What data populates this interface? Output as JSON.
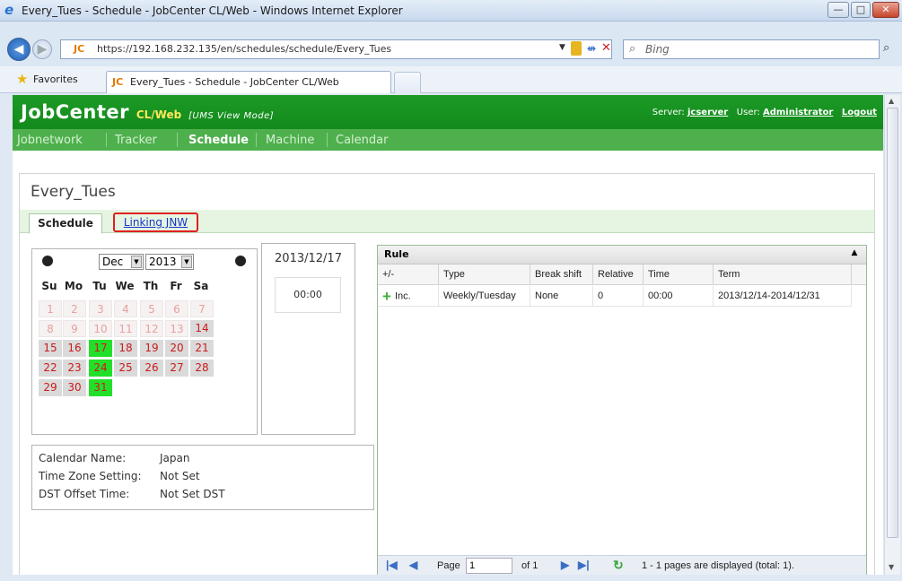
{
  "window": {
    "title": "Every_Tues - Schedule - JobCenter CL/Web - Windows Internet Explorer",
    "minimize": "—",
    "maximize": "□",
    "close": "✕"
  },
  "browser": {
    "back_glyph": "◀",
    "forward_glyph": "▶",
    "site_icon": "JC",
    "url": "https://192.168.232.135/en/schedules/schedule/Every_Tues",
    "search_placeholder": "Bing",
    "search_glyph": "⌕",
    "favorites": "Favorites",
    "tab_title": "Every_Tues - Schedule - JobCenter CL/Web"
  },
  "app": {
    "brand": "JobCenter",
    "brand_sub": "CL/Web",
    "mode": "[UMS View Mode]",
    "server_label": "Server:",
    "server_value": "jcserver",
    "user_label": "User:",
    "user_value": "Administrator",
    "logout": "Logout"
  },
  "menu": {
    "items": [
      "Jobnetwork",
      "Tracker",
      "Schedule",
      "Machine",
      "Calendar"
    ],
    "active": "Schedule"
  },
  "page_title": "Every_Tues",
  "tabs": {
    "schedule": "Schedule",
    "linking": "Linking JNW"
  },
  "calendar": {
    "prev_glyph": "●",
    "next_glyph": "●",
    "month": "Dec",
    "year": "2013",
    "dropdown_glyph": "▼",
    "weekdays": [
      "Su",
      "Mo",
      "Tu",
      "We",
      "Th",
      "Fr",
      "Sa"
    ],
    "weeks": [
      [
        "1",
        "2",
        "3",
        "4",
        "5",
        "6",
        "7"
      ],
      [
        "8",
        "9",
        "10",
        "11",
        "12",
        "13",
        "14"
      ],
      [
        "15",
        "16",
        "17",
        "18",
        "19",
        "20",
        "21"
      ],
      [
        "22",
        "23",
        "24",
        "25",
        "26",
        "27",
        "28"
      ],
      [
        "29",
        "30",
        "31",
        "",
        "",
        "",
        ""
      ]
    ],
    "disabled_days": [
      "1",
      "2",
      "3",
      "4",
      "5",
      "6",
      "7",
      "8",
      "9",
      "10",
      "11",
      "12",
      "13"
    ],
    "highlighted_days": [
      "17",
      "24",
      "31"
    ],
    "selected_date": "2013/12/17",
    "time": "00:00"
  },
  "info": {
    "calendar_name_label": "Calendar Name:",
    "calendar_name_value": "Japan",
    "timezone_label": "Time Zone Setting:",
    "timezone_value": "Not Set",
    "dst_label": "DST Offset Time:",
    "dst_value": "Not Set DST"
  },
  "rule_grid": {
    "title": "Rule",
    "collapse_glyph": "▲",
    "columns": [
      "+/-",
      "Type",
      "Break shift",
      "Relative",
      "Time",
      "Term"
    ],
    "rows": [
      {
        "sign": "+",
        "inc": "Inc.",
        "type": "Weekly/Tuesday",
        "break_shift": "None",
        "relative": "0",
        "time": "00:00",
        "term": "2013/12/14-2014/12/31"
      }
    ],
    "pager": {
      "first": "|◀",
      "prev": "◀",
      "page_label": "Page",
      "page_value": "1",
      "of": "of 1",
      "next": "▶",
      "last": "▶|",
      "refresh": "↻",
      "status": "1 - 1 pages are displayed (total: 1)."
    }
  },
  "colors": {
    "header_green": "#1c9a26",
    "menu_green": "#4eb04d",
    "highlight_day": "#22e02a",
    "day_text": "#cc1a1a",
    "link_tab_outline": "#e02020"
  }
}
